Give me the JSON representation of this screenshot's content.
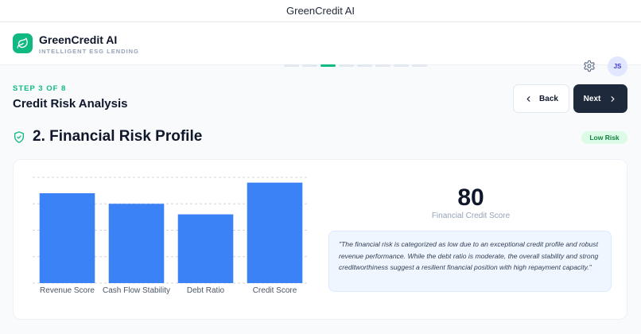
{
  "window": {
    "title": "GreenCredit AI"
  },
  "header": {
    "brand_name": "GreenCredit AI",
    "brand_tagline": "INTELLIGENT ESG LENDING",
    "progress": {
      "total_steps": 8,
      "current_step": 3
    },
    "settings_icon": "gear-icon",
    "avatar_initials": "JS"
  },
  "step": {
    "label": "STEP 3 OF 8",
    "title": "Credit Risk Analysis",
    "back_label": "Back",
    "next_label": "Next"
  },
  "section": {
    "title": "2. Financial Risk Profile",
    "icon": "shield-check-icon",
    "risk_badge": "Low Risk"
  },
  "score": {
    "value": "80",
    "label": "Financial Credit Score"
  },
  "summary": "\"The financial risk is categorized as low due to an exceptional credit profile and robust revenue performance. While the debt ratio is moderate, the overall stability and strong creditworthiness suggest a resilient financial position with high repayment capacity.\"",
  "colors": {
    "accent_green": "#10b981",
    "bar_blue": "#3b82f6",
    "dark_button": "#1e293b",
    "badge_green_bg": "#dcfce7"
  },
  "chart_data": {
    "type": "bar",
    "categories": [
      "Revenue Score",
      "Cash Flow Stability",
      "Debt Ratio",
      "Credit Score"
    ],
    "values": [
      85,
      75,
      65,
      95
    ],
    "ylim": [
      0,
      100
    ],
    "grid": true,
    "title": "",
    "xlabel": "",
    "ylabel": ""
  }
}
